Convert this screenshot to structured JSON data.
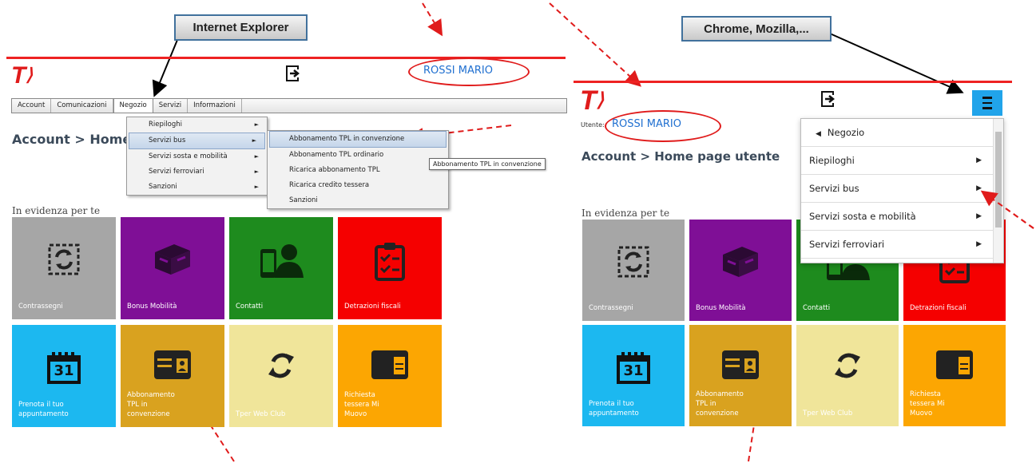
{
  "callouts": {
    "ie": "Internet Explorer",
    "chrome": "Chrome, Mozilla,..."
  },
  "logo": "T",
  "left": {
    "user": "ROSSI MARIO",
    "menu": [
      "Account",
      "Comunicazioni",
      "Negozio",
      "Servizi",
      "Informazioni"
    ],
    "submenu": [
      "Riepiloghi",
      "Servizi bus",
      "Servizi sosta e mobilità",
      "Servizi ferroviari",
      "Sanzioni"
    ],
    "submenu2": [
      "Abbonamento TPL in convenzione",
      "Abbonamento TPL ordinario",
      "Ricarica abbonamento TPL",
      "Ricarica credito tessera",
      "Sanzioni"
    ],
    "tooltip": "Abbonamento TPL in convenzione",
    "breadcrumb": "Account > Home",
    "section": "In evidenza per te"
  },
  "right": {
    "user_prefix": "Utente:",
    "user": "ROSSI MARIO",
    "breadcrumb": "Account > Home page utente",
    "section": "In evidenza per te",
    "menu_back": "Negozio",
    "menu_items": [
      "Riepiloghi",
      "Servizi bus",
      "Servizi sosta e mobilità",
      "Servizi ferroviari"
    ]
  },
  "tiles": [
    {
      "label": "Contrassegni",
      "color": "#a6a6a6",
      "icon": "recycle-icon"
    },
    {
      "label": "Bonus Mobilità",
      "color": "#7f0f96",
      "icon": "treasure-chest-icon"
    },
    {
      "label": "Contatti",
      "color": "#1e8b1e",
      "icon": "contact-phone-icon"
    },
    {
      "label": "Detrazioni fiscali",
      "color": "#f50000",
      "icon": "clipboard-check-icon"
    },
    {
      "label": "Prenota il tuo appuntamento",
      "color": "#1cb8f0",
      "icon": "calendar-icon"
    },
    {
      "label": "Abbonamento TPL in convenzione",
      "color": "#d9a21f",
      "icon": "id-card-icon"
    },
    {
      "label": "Tper Web Club",
      "color": "#f0e59a",
      "icon": "refresh-icon"
    },
    {
      "label": "Richiesta tessera Mi Muovo",
      "color": "#fca602",
      "icon": "card-icon"
    }
  ],
  "calendar_day": "31",
  "colors": {
    "accent_red": "#e01b1b",
    "link_blue": "#1f6fd0",
    "hamburger": "#21a4ea"
  }
}
